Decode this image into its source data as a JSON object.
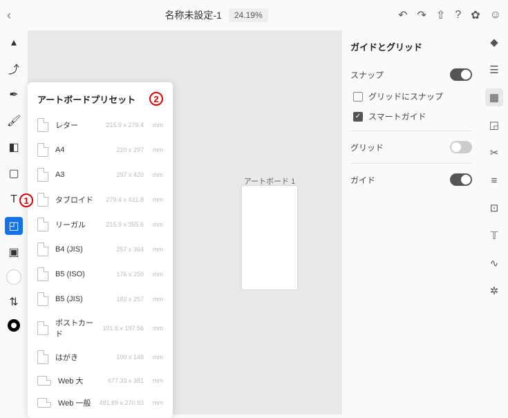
{
  "header": {
    "doc_title": "名称未設定-1",
    "zoom": "24.19%"
  },
  "canvas": {
    "artboard_label": "アートボード 1"
  },
  "preset_panel": {
    "title": "アートボードプリセット",
    "items": [
      {
        "name": "レター",
        "size": "215.9 x 279.4",
        "unit": "mm",
        "landscape": false
      },
      {
        "name": "A4",
        "size": "210 x 297",
        "unit": "mm",
        "landscape": false
      },
      {
        "name": "A3",
        "size": "297 x 420",
        "unit": "mm",
        "landscape": false
      },
      {
        "name": "タブロイド",
        "size": "279.4 x 431.8",
        "unit": "mm",
        "landscape": false
      },
      {
        "name": "リーガル",
        "size": "215.9 x 355.6",
        "unit": "mm",
        "landscape": false
      },
      {
        "name": "B4 (JIS)",
        "size": "257 x 364",
        "unit": "mm",
        "landscape": false
      },
      {
        "name": "B5 (ISO)",
        "size": "176 x 250",
        "unit": "mm",
        "landscape": false
      },
      {
        "name": "B5 (JIS)",
        "size": "182 x 257",
        "unit": "mm",
        "landscape": false
      },
      {
        "name": "ポストカード",
        "size": "101.6 x 197.56",
        "unit": "mm",
        "landscape": false
      },
      {
        "name": "はがき",
        "size": "100 x 148",
        "unit": "mm",
        "landscape": false
      },
      {
        "name": "Web 大",
        "size": "677.33 x 381",
        "unit": "mm",
        "landscape": true
      },
      {
        "name": "Web 一般",
        "size": "481.89 x 270.93",
        "unit": "mm",
        "landscape": true
      }
    ]
  },
  "right_panel": {
    "title": "ガイドとグリッド",
    "snap_label": "スナップ",
    "snap_on": true,
    "grid_snap_label": "グリッドにスナップ",
    "grid_snap_checked": false,
    "smart_guide_label": "スマートガイド",
    "smart_guide_checked": true,
    "grid_label": "グリッド",
    "grid_on": false,
    "guide_label": "ガイド",
    "guide_on": true
  },
  "annotations": {
    "one": "1",
    "two": "2"
  }
}
